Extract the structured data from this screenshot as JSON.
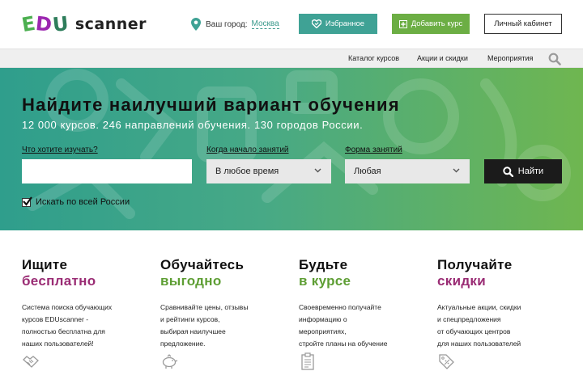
{
  "header": {
    "logo_letters": [
      "E",
      "D",
      "U"
    ],
    "logo_word": "scanner",
    "city_label": "Ваш город:",
    "city_value": "Москва",
    "favorites_label": "Избранное",
    "add_course_label": "Добавить курс",
    "cabinet_label": "Личный кабинет"
  },
  "nav": {
    "items": [
      "Каталог курсов",
      "Акции и скидки",
      "Мероприятия"
    ]
  },
  "hero": {
    "title": "Найдите наилучший вариант обучения",
    "subtitle": "12 000 курсов. 246 направлений обучения. 130 городов России.",
    "what_label": "Что хотите изучать?",
    "what_value": "",
    "when_label": "Когда начало занятий",
    "when_value": "В любое время",
    "form_label": "Форма занятий",
    "form_value": "Любая",
    "find_label": "Найти",
    "checkbox_label": "Искать по всей России",
    "checkbox_checked": true
  },
  "features": [
    {
      "title1": "Ищите",
      "title2": "бесплатно",
      "accent": "#9a2c74",
      "desc": [
        "Система поиска обучающих",
        "курсов EDUscanner -",
        "полностью бесплатна для",
        "наших пользователей!"
      ],
      "icon": "handshake-icon"
    },
    {
      "title1": "Обучайтесь",
      "title2": "выгодно",
      "accent": "#5e9e34",
      "desc": [
        "Сравнивайте цены, отзывы",
        "и рейтинги курсов,",
        "выбирая наилучшее",
        "предложение."
      ],
      "icon": "piggy-bank-icon"
    },
    {
      "title1": "Будьте",
      "title2": "в курсе",
      "accent": "#5e9e34",
      "desc": [
        "Своевременно получайте",
        "информацию о",
        "мероприятиях,",
        "стройте планы на обучение"
      ],
      "icon": "clipboard-icon"
    },
    {
      "title1": "Получайте",
      "title2": "скидки",
      "accent": "#9a2c74",
      "desc": [
        "Актуальные акции, скидки",
        "и спецпредложения",
        "от обучающих центров",
        "для наших пользователей"
      ],
      "icon": "discount-tag-icon"
    }
  ],
  "colors": {
    "teal": "#3fa295",
    "green": "#6cae44",
    "purple": "#9a2c74",
    "dark": "#1b1b1b"
  }
}
